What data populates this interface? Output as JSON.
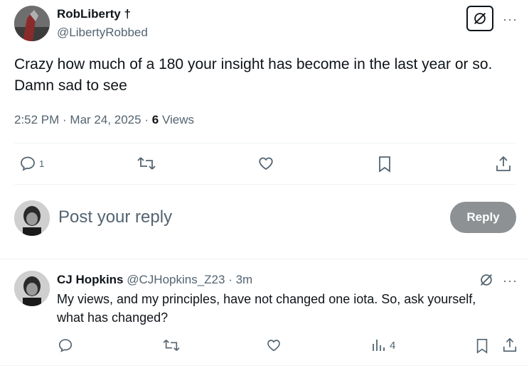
{
  "tweet": {
    "author_name": "RobLiberty †",
    "author_handle": "@LibertyRobbed",
    "text_line1": "Crazy how much of a 180 your insight has become in the last year or so.",
    "text_line2": "Damn sad to see",
    "time": "2:52 PM · Mar 24, 2025",
    "views_sep": "·",
    "views_count": "6",
    "views_label": "Views",
    "actions": {
      "reply_count": "1"
    }
  },
  "composer": {
    "placeholder": "Post your reply",
    "reply_button": "Reply"
  },
  "reply": {
    "author_name": "CJ Hopkins",
    "author_handle": "@CJHopkins_Z23",
    "time": "· 3m",
    "text_line1": "My views, and my principles, have not changed one iota. So, ask yourself,",
    "text_line2": "what has changed?",
    "views_count": "4"
  },
  "icons": {
    "more": "···"
  }
}
